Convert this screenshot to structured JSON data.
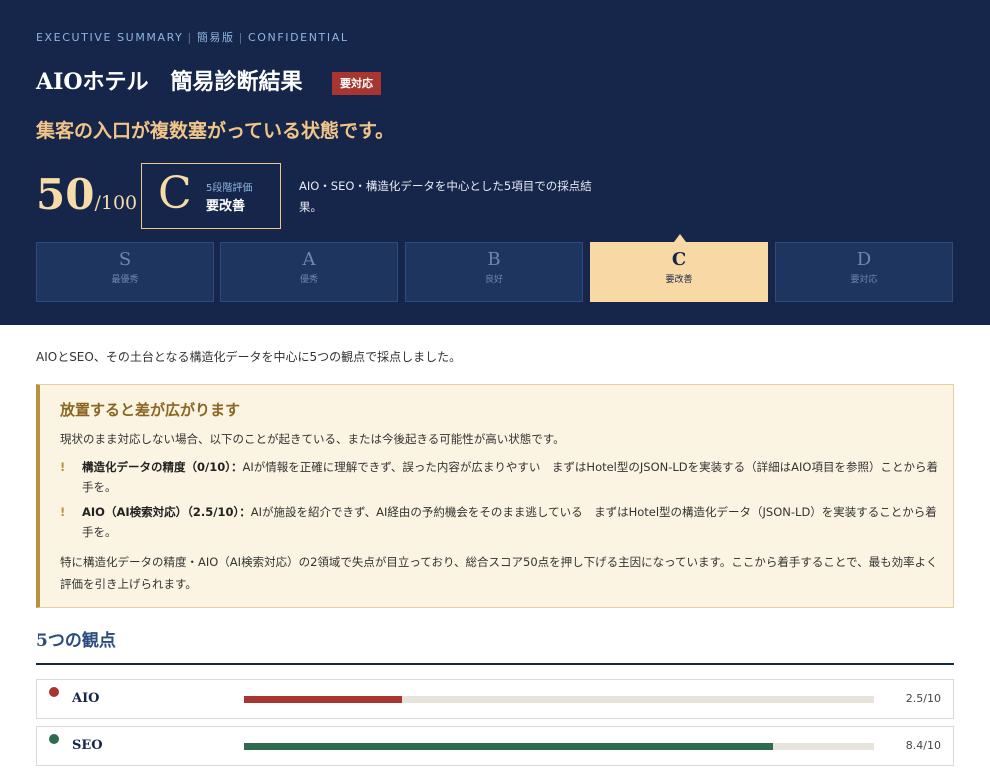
{
  "header": {
    "eyebrow_left": "EXECUTIVE SUMMARY",
    "eyebrow_mid": "簡易版",
    "eyebrow_right": "CONFIDENTIAL",
    "title": "AIOホテル　簡易診断結果",
    "urgent_badge": "要対応",
    "headline": "集客の入口が複数塞がっている状態です。"
  },
  "score": {
    "value": "50",
    "denominator": "/100",
    "grade_letter": "C",
    "grade_caption": "5段階評価",
    "grade_label": "要改善",
    "description": "AIO・SEO・構造化データを中心とした5項目での採点結果。"
  },
  "grade_scale": {
    "active": "C",
    "items": [
      {
        "letter": "S",
        "label": "最優秀"
      },
      {
        "letter": "A",
        "label": "優秀"
      },
      {
        "letter": "B",
        "label": "良好"
      },
      {
        "letter": "C",
        "label": "要改善"
      },
      {
        "letter": "D",
        "label": "要対応"
      }
    ]
  },
  "intro": "AIOとSEO、その土台となる構造化データを中心に5つの観点で採点しました。",
  "notice": {
    "title": "放置すると差が広がります",
    "lead": "現状のまま対応しない場合、以下のことが起きている、または今後起きる可能性が高い状態です。",
    "items": [
      {
        "bang": "!",
        "heading": "構造化データの精度（0/10）：",
        "body": "AIが情報を正確に理解できず、誤った内容が広まりやすい　まずはHotel型のJSON-LDを実装する（詳細はAIO項目を参照）ことから着手を。"
      },
      {
        "bang": "!",
        "heading": "AIO（AI検索対応）（2.5/10）：",
        "body": "AIが施設を紹介できず、AI経由の予約機会をそのまま逃している　まずはHotel型の構造化データ（JSON-LD）を実装することから着手を。"
      }
    ],
    "footer": "特に構造化データの精度・AIO（AI検索対応）の2領域で失点が目立っており、総合スコア50点を押し下げる主因になっています。ここから着手することで、最も効率よく評価を引き上げられます。"
  },
  "viewpoints": {
    "title": "5つの観点",
    "items": [
      {
        "name": "AIO",
        "score": 2.5,
        "max": 10,
        "display": "2.5/10",
        "color": "#a8352f"
      },
      {
        "name": "SEO",
        "score": 8.4,
        "max": 10,
        "display": "8.4/10",
        "color": "#2f6b4f"
      }
    ]
  }
}
